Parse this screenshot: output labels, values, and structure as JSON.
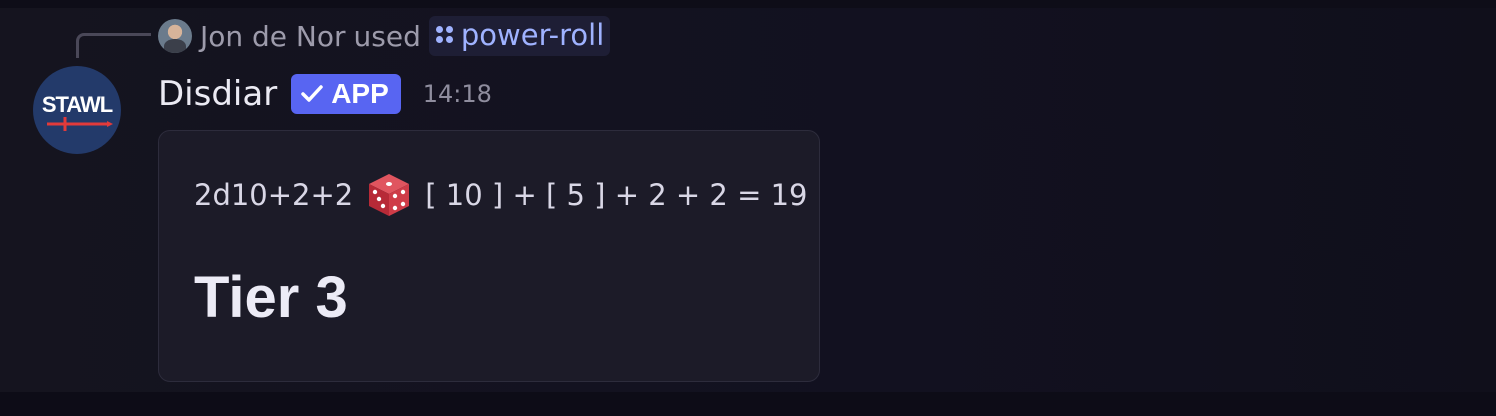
{
  "reply": {
    "user": "Jon de Nor",
    "used_text": "used",
    "command": "power-roll"
  },
  "message": {
    "avatar_text": "STAWL",
    "bot_name": "Disdiar",
    "badge": "APP",
    "timestamp": "14:18"
  },
  "result": {
    "formula": "2d10+2+2",
    "breakdown": "[ 10 ] + [ 5 ] + 2 + 2 = 19",
    "tier": "Tier 3"
  },
  "colors": {
    "accent": "#5865f2",
    "command": "#9fb2ff",
    "die": "#c9323f"
  },
  "icons": {
    "command": "slash-command-icon",
    "badge": "checkmark-icon",
    "roll": "game-die-icon"
  }
}
